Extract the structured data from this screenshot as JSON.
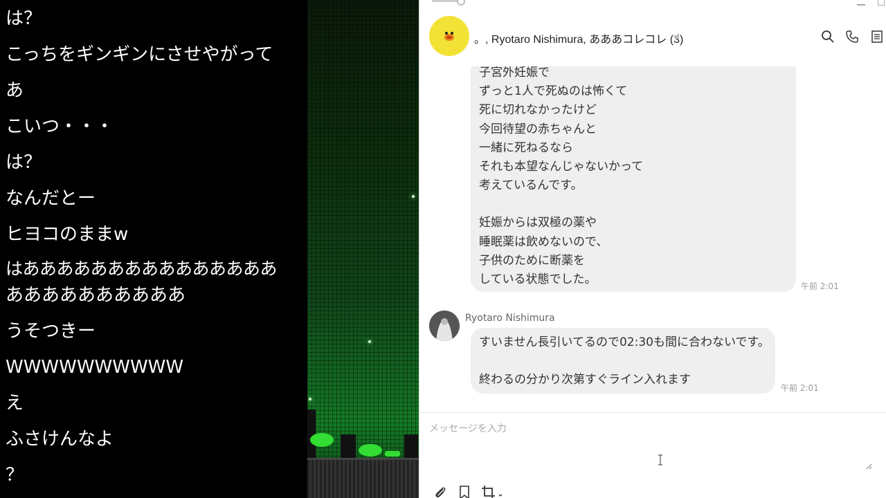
{
  "comments": [
    "は？",
    "こっちをギンギンにさせやがって",
    "あ",
    "こいつ・・・",
    "は？",
    "なんだとー",
    "ヒヨコのままw",
    "はあああああああああああああああ",
    "ああああああああああ",
    "うそつきー",
    "WWWWWWWWWW",
    "え",
    "ふさけんなよ",
    "？"
  ],
  "chat": {
    "title": "。, Ryotaro Nishimura, あああコレコレ (3)",
    "messages": [
      {
        "lines": [
          "子宮外妊娠で",
          "ずっと1人で死ぬのは怖くて",
          "死に切れなかったけど",
          "今回待望の赤ちゃんと",
          "一緒に死ねるなら",
          "それも本望なんじゃないかって",
          "考えているんです。",
          "",
          "妊娠からは双極の薬や",
          "睡眠薬は飲めないので、",
          "子供のために断薬を",
          "している状態でした。"
        ],
        "time": "午前 2:01"
      },
      {
        "sender": "Ryotaro Nishimura",
        "lines": [
          "すいません長引いてるので02:30も間に合わないです。",
          "",
          "終わるの分かり次第すぐライン入れます"
        ],
        "time": "午前 2:01"
      }
    ],
    "composer": {
      "placeholder": "メッセージを入力"
    },
    "icons": [
      "search-icon",
      "phone-icon",
      "menu-icon",
      "mute-icon",
      "attach-icon",
      "bookmark-icon",
      "crop-icon"
    ]
  }
}
